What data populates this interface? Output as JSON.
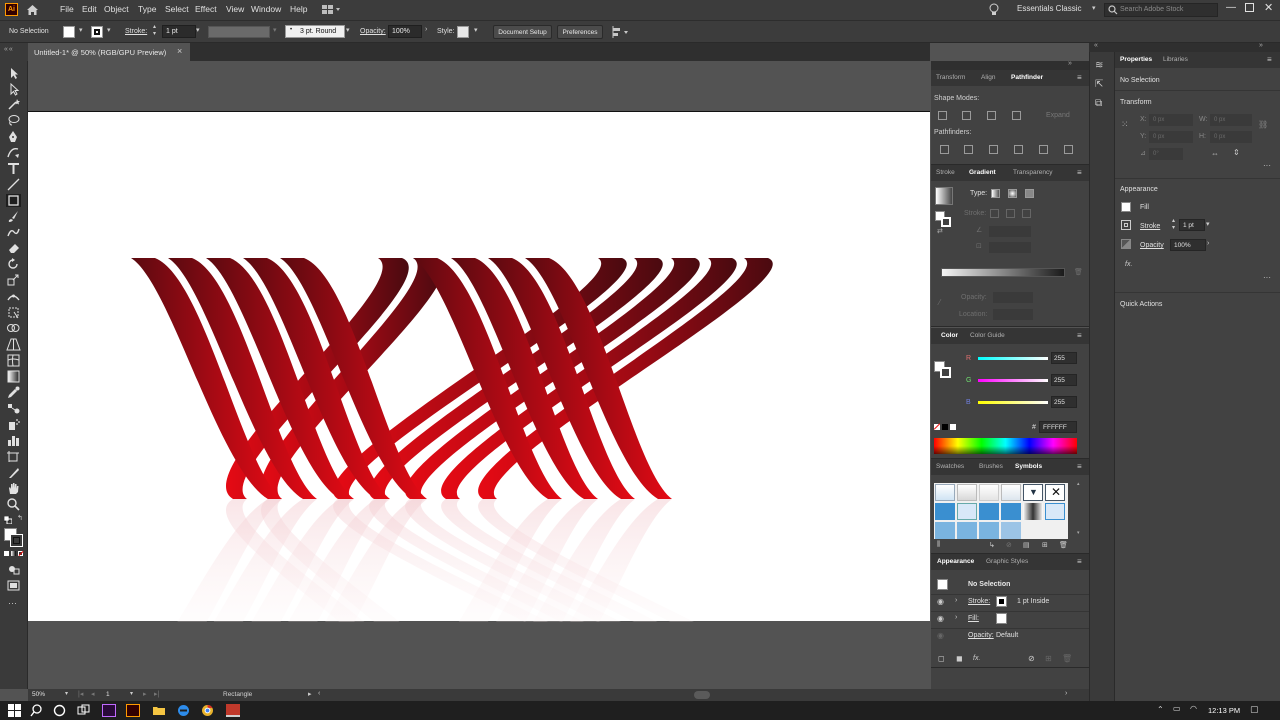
{
  "menubar": {
    "app_icon_text": "Ai",
    "menus": [
      "File",
      "Edit",
      "Object",
      "Type",
      "Select",
      "Effect",
      "View",
      "Window",
      "Help"
    ],
    "workspace": "Essentials Classic",
    "search_placeholder": "Search Adobe Stock"
  },
  "control": {
    "selection": "No Selection",
    "stroke_label": "Stroke:",
    "stroke_value": "1 pt",
    "brush": "3 pt. Round",
    "opacity_label": "Opacity:",
    "opacity_value": "100%",
    "style_label": "Style:",
    "document_setup": "Document Setup",
    "preferences": "Preferences"
  },
  "document": {
    "tab_title": "Untitled-1* @ 50% (RGB/GPU Preview)",
    "close": "×"
  },
  "pathfinder_panel": {
    "tabs": [
      "Transform",
      "Align",
      "Pathfinder"
    ],
    "shape_modes": "Shape Modes:",
    "expand": "Expand",
    "pathfinders": "Pathfinders:"
  },
  "gradient_panel": {
    "tabs": [
      "Stroke",
      "Gradient",
      "Transparency"
    ],
    "type": "Type:",
    "stroke": "Stroke:",
    "opacity": "Opacity:",
    "location": "Location:"
  },
  "color_panel": {
    "tabs": [
      "Color",
      "Color Guide"
    ],
    "r_label": "R",
    "g_label": "G",
    "b_label": "B",
    "r": "255",
    "g": "255",
    "b": "255",
    "hash": "#",
    "hex": "FFFFFF"
  },
  "symbols_panel": {
    "tabs": [
      "Swatches",
      "Brushes",
      "Symbols"
    ]
  },
  "appearance_panel": {
    "tabs": [
      "Appearance",
      "Graphic Styles"
    ],
    "title": "No Selection",
    "stroke_label": "Stroke:",
    "stroke_value": "1 pt  Inside",
    "fill_label": "Fill:",
    "opacity_label": "Opacity:",
    "opacity_value": "Default",
    "fx": "fx."
  },
  "properties_panel": {
    "tabs": [
      "Properties",
      "Libraries"
    ],
    "selection": "No Selection",
    "transform": "Transform",
    "x_label": "X:",
    "y_label": "Y:",
    "w_label": "W:",
    "h_label": "H:",
    "x_ph": "0 px",
    "y_ph": "0 px",
    "w_ph": "0 px",
    "h_ph": "0 px",
    "angle_ph": "0°",
    "appearance": "Appearance",
    "fill": "Fill",
    "stroke": "Stroke",
    "stroke_value": "1 pt",
    "opacity": "Opacity",
    "opacity_value": "100%",
    "fx": "fx.",
    "quick_actions": "Quick Actions"
  },
  "status": {
    "zoom": "50%",
    "artboard": "1",
    "tool": "Rectangle"
  },
  "taskbar": {
    "time": "12:13 PM"
  },
  "colors": {
    "accent_blue": "#2d8ceb",
    "ribbon_bright": "#e00a14",
    "ribbon_dark": "#5a0a10"
  }
}
